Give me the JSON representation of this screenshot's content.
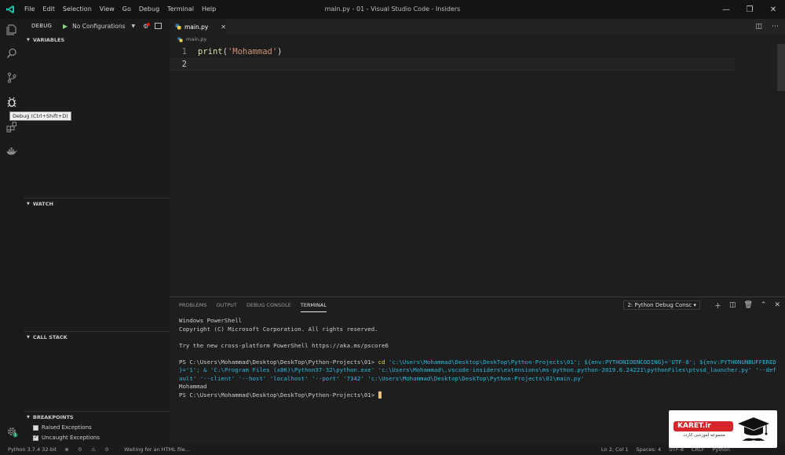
{
  "titlebar": {
    "menu": [
      "File",
      "Edit",
      "Selection",
      "View",
      "Go",
      "Debug",
      "Terminal",
      "Help"
    ],
    "window_title": "main.py - 01 - Visual Studio Code - Insiders"
  },
  "tooltip": "Debug (Ctrl+Shift+D)",
  "sidebar": {
    "title": "DEBUG",
    "configuration": "No Configurations",
    "sections": {
      "variables": "VARIABLES",
      "watch": "WATCH",
      "call_stack": "CALL STACK",
      "breakpoints": "BREAKPOINTS"
    },
    "breakpoints": [
      {
        "label": "Raised Exceptions",
        "checked": false
      },
      {
        "label": "Uncaught Exceptions",
        "checked": true
      }
    ]
  },
  "editor": {
    "tab": "main.py",
    "breadcrumb": "main.py",
    "lines": [
      {
        "number": "1",
        "fn": "print",
        "open": "(",
        "str": "'Mohammad'",
        "close": ")"
      },
      {
        "number": "2"
      }
    ]
  },
  "panel": {
    "tabs": [
      "PROBLEMS",
      "OUTPUT",
      "DEBUG CONSOLE",
      "TERMINAL"
    ],
    "active_tab": "TERMINAL",
    "terminal_select": "2: Python Debug Consc",
    "terminal_lines": {
      "l1": "Windows PowerShell",
      "l2": "Copyright (C) Microsoft Corporation. All rights reserved.",
      "l3": "Try the new cross-platform PowerShell https://aka.ms/pscore6",
      "l4_prompt": "PS C:\\Users\\Mohammad\\Desktop\\DeskTop\\Python-Projects\\01> ",
      "l4_cmd": "cd",
      "l4_rest": " 'c:\\Users\\Mohammad\\Desktop\\DeskTop\\Python-Projects\\01'; ${env:PYTHONIOENCODING}='UTF-8'; ${env:PYTHONUNBUFFERED",
      "l5": "}='1'; & 'C:\\Program Files (x86)\\Python37-32\\python.exe' 'c:\\Users\\Mohammad\\.vscode-insiders\\extensions\\ms-python.python-2019.6.24221\\pythonFiles\\ptvsd_launcher.py' '--def",
      "l6": "ault' '--client' '--host' 'localhost' '--port' '7342' 'c:\\Users\\Mohammad\\Desktop\\DeskTop\\Python-Projects\\01\\main.py'",
      "l7": "Mohammad",
      "l8": "PS C:\\Users\\Mohammad\\Desktop\\DeskTop\\Python-Projects\\01> "
    }
  },
  "statusbar": {
    "python": "Python 3.7.4 32-bit",
    "errors": "0",
    "warnings": "0",
    "message": "Waiting for an HTML file...",
    "position": "Ln 2, Col 1",
    "spaces": "Spaces: 4",
    "encoding": "UTF-8",
    "eol": "CRLF",
    "language": "Python"
  },
  "watermark": {
    "brand": "KARET.ir",
    "subtitle": "مجموعه آموزشی کارت"
  },
  "colors": {
    "accent": "#007acc",
    "debug_play": "#89d185",
    "string": "#ce9178",
    "function": "#dcdcaa",
    "cursor": "#e5c07b",
    "brand_red": "#d6262b"
  }
}
